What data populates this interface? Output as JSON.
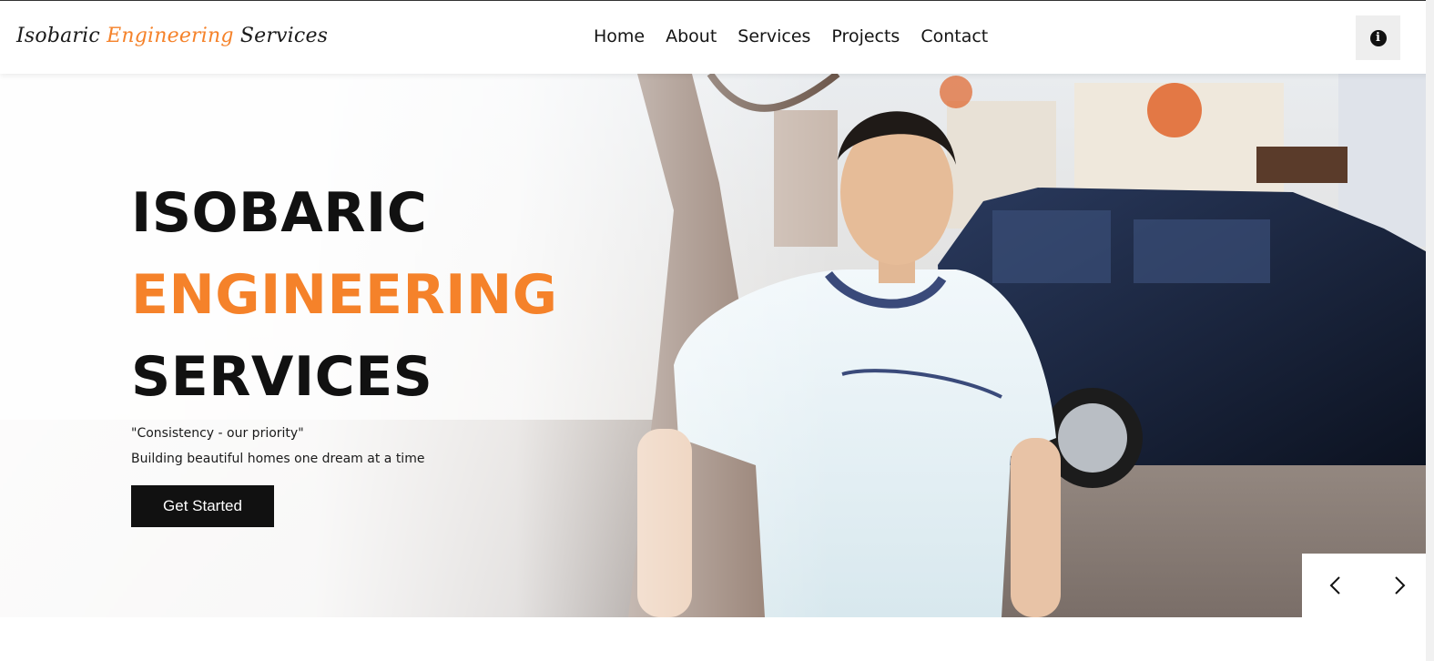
{
  "brand": {
    "part1": "Isobaric ",
    "part2": "Engineering",
    "part3": " Services",
    "accent_color": "#f5822a"
  },
  "nav": {
    "items": [
      {
        "label": "Home"
      },
      {
        "label": "About"
      },
      {
        "label": "Services"
      },
      {
        "label": "Projects"
      },
      {
        "label": "Contact"
      }
    ],
    "info_icon": "info-circle-icon"
  },
  "hero": {
    "line1": "ISOBARIC",
    "line2": "ENGINEERING",
    "line3": "SERVICES",
    "quote": "\"Consistency - our priority\"",
    "subtitle": "Building beautiful homes one dream at a time",
    "cta_label": "Get Started",
    "prev_icon": "chevron-left-icon",
    "next_icon": "chevron-right-icon"
  }
}
